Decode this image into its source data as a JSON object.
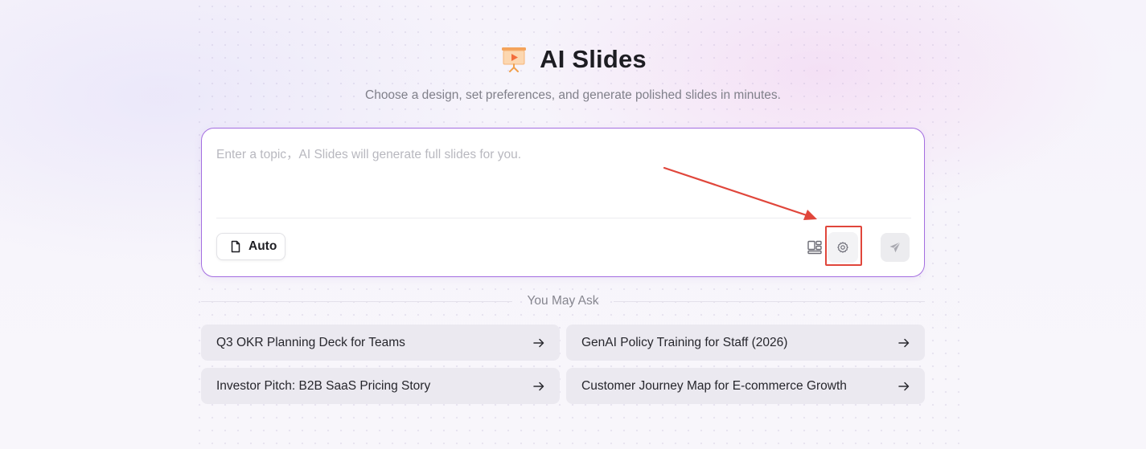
{
  "header": {
    "title": "AI Slides",
    "subtitle": "Choose a design, set preferences, and generate polished slides in minutes.",
    "logo_icon": "presentation-board-icon"
  },
  "composer": {
    "placeholder": "Enter a topic，AI Slides will generate full slides for you.",
    "value": "",
    "auto_label": "Auto",
    "auto_icon": "document-icon",
    "layout_icon": "layout-icon",
    "settings_icon": "gear-icon",
    "send_icon": "send-icon"
  },
  "suggestions": {
    "heading": "You May Ask",
    "items": [
      {
        "label": "Q3 OKR Planning Deck for Teams"
      },
      {
        "label": "GenAI Policy Training for Staff (2026)"
      },
      {
        "label": "Investor Pitch: B2B SaaS Pricing Story"
      },
      {
        "label": "Customer Journey Map for E-commerce Growth"
      }
    ]
  },
  "colors": {
    "accent_border": "#a46ee0",
    "annotation_red": "#e0463b",
    "logo_orange": "#f6a14a"
  }
}
